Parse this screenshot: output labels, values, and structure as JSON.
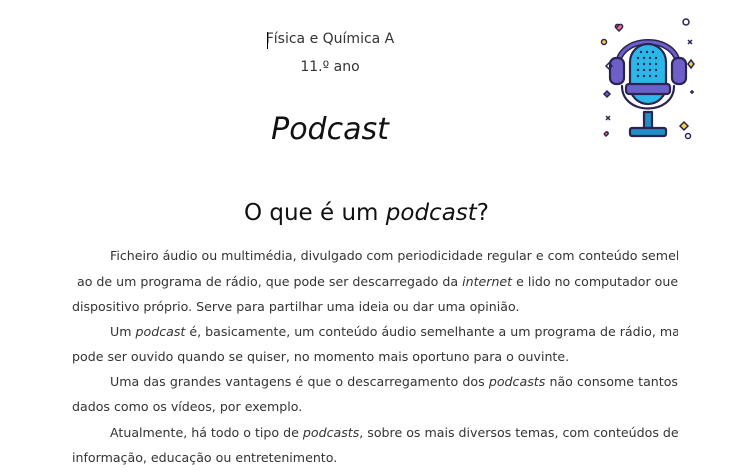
{
  "header": {
    "subject": "Física e Química A",
    "grade": "11.º ano"
  },
  "title": "Podcast",
  "section": {
    "heading_pre": "O que é um ",
    "heading_em": "podcast",
    "heading_post": "?"
  },
  "paragraphs": {
    "p1_l1": "Ficheiro áudio ou multimédia, divulgado com periodicidade regular e com conteúdo semelhante",
    "p1_l2_a": "ao de um programa de rádio, que pode ser descarregado da ",
    "p1_l2_em": "internet",
    "p1_l2_b": " e lido no computador ou",
    "p1_l2_c": "em",
    "p1_l3": "dispositivo próprio. Serve para partilhar uma ideia ou dar uma opinião.",
    "p2_l1_a": "Um ",
    "p2_l1_em": "podcast",
    "p2_l1_b": " é, basicamente, um conteúdo áudio semelhante a um programa de rádio, mas que",
    "p2_l2": "pode ser ouvido quando se quiser, no momento mais oportuno para o ouvinte.",
    "p3_l1_a": "Uma das grandes vantagens é que o descarregamento dos ",
    "p3_l1_em": "podcasts",
    "p3_l1_b": " não consome tantos",
    "p3_l2": "dados como os vídeos, por exemplo.",
    "p4_l1_a": "Atualmente, há todo o tipo de ",
    "p4_l1_em": "podcasts",
    "p4_l1_b": ", sobre os mais diversos temas, com conteúdos de",
    "p4_l2": "informação, educação ou entretenimento."
  },
  "illustration": {
    "icon": "microphone-headphones-icon",
    "colors": {
      "outline": "#2b2450",
      "mic_body": "#2bb8e8",
      "headphones": "#6c5fc7",
      "stand": "#1f8fc6",
      "heart": "#ff6f91",
      "star": "#ffd23f",
      "sparkle": "#2b2450"
    }
  }
}
